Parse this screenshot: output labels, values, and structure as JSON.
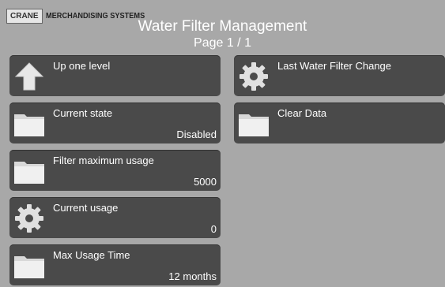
{
  "header": {
    "logo_box": "CRANE",
    "logo_text": "MERCHANDISING SYSTEMS",
    "title": "Water Filter Management",
    "page": "Page 1 / 1"
  },
  "tiles": [
    {
      "label": "Up one level",
      "value": "",
      "icon": "up-arrow-icon"
    },
    {
      "label": "Current state",
      "value": "Disabled",
      "icon": "folder-icon"
    },
    {
      "label": "Filter maximum usage",
      "value": "5000",
      "icon": "folder-icon"
    },
    {
      "label": "Current usage",
      "value": "0",
      "icon": "gear-icon"
    },
    {
      "label": "Max Usage Time",
      "value": "12 months",
      "icon": "folder-icon"
    },
    {
      "label": "Last Water Filter Change",
      "value": "",
      "icon": "gear-icon"
    },
    {
      "label": "Clear Data",
      "value": "",
      "icon": "folder-icon"
    }
  ]
}
